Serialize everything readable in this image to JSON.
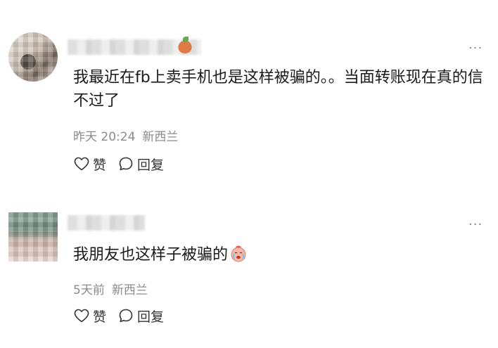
{
  "comments": [
    {
      "text": "我最近在fb上卖手机也是这样被骗的。。当面转账现在真的信不过了",
      "time": "昨天 20:24",
      "location": "新西兰",
      "like_label": "赞",
      "reply_label": "回复",
      "more_icon": "more-icon"
    },
    {
      "text": "我朋友也这样子被骗的",
      "time": "5天前",
      "location": "新西兰",
      "like_label": "赞",
      "reply_label": "回复",
      "more_icon": "more-icon"
    }
  ],
  "more_glyph": "···"
}
